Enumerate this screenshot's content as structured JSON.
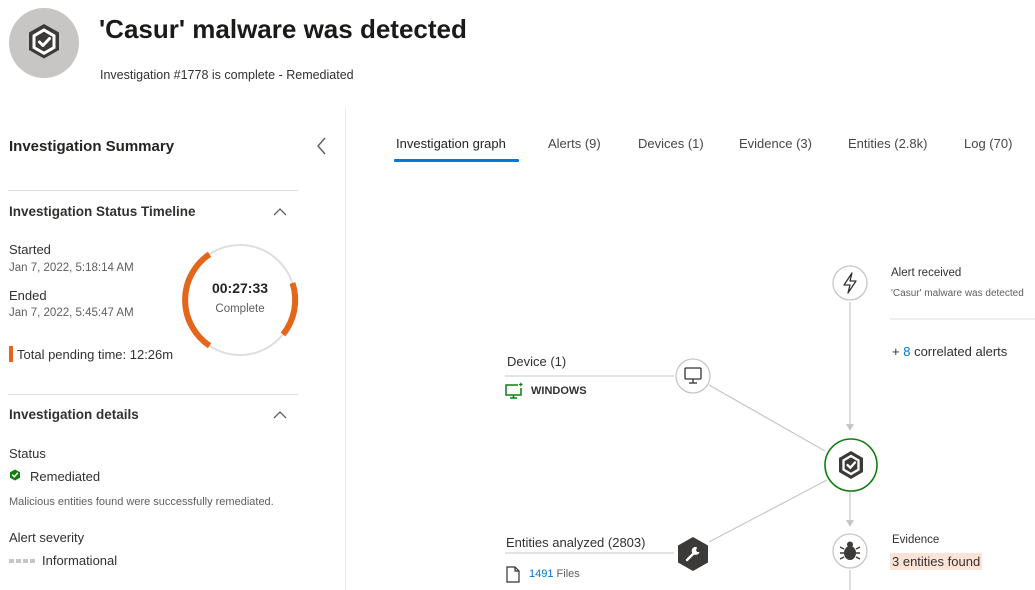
{
  "header": {
    "title": "'Casur' malware was detected",
    "subtitle": "Investigation #1778 is complete - Remediated"
  },
  "summary": {
    "title": "Investigation Summary",
    "timeline": {
      "title": "Investigation Status Timeline",
      "started_label": "Started",
      "started_value": "Jan 7, 2022, 5:18:14 AM",
      "ended_label": "Ended",
      "ended_value": "Jan 7, 2022, 5:45:47 AM",
      "duration": "00:27:33",
      "status": "Complete",
      "pending_label": "Total pending time: 12:26m"
    },
    "details": {
      "title": "Investigation details",
      "status_label": "Status",
      "status_value": "Remediated",
      "status_desc": "Malicious entities found were successfully remediated.",
      "severity_label": "Alert severity",
      "severity_value": "Informational"
    }
  },
  "tabs": [
    {
      "label": "Investigation graph"
    },
    {
      "label": "Alerts  (9)"
    },
    {
      "label": "Devices  (1)"
    },
    {
      "label": "Evidence  (3)"
    },
    {
      "label": "Entities  (2.8k)"
    },
    {
      "label": "Log  (70)"
    }
  ],
  "graph": {
    "alert": {
      "title": "Alert received",
      "subtitle": "'Casur' malware was detected",
      "correlated_prefix": "+ ",
      "correlated_count": "8",
      "correlated_suffix": " correlated alerts"
    },
    "device": {
      "title": "Device (1)",
      "name": "WINDOWS"
    },
    "entities": {
      "title": "Entities analyzed (2803)",
      "files_count": "1491",
      "files_label": "Files"
    },
    "evidence": {
      "title": "Evidence",
      "value": "3 entities found"
    }
  },
  "colors": {
    "accent": "#0078d4",
    "orange": "#e3661a",
    "green": "#107c10",
    "icon_dark": "#3b3a39"
  },
  "icons": [
    "shield-check-icon",
    "chevron-left-icon",
    "chevron-up-icon",
    "lightning-icon",
    "monitor-icon",
    "bug-icon",
    "wrench-icon",
    "file-icon",
    "device-icon"
  ]
}
